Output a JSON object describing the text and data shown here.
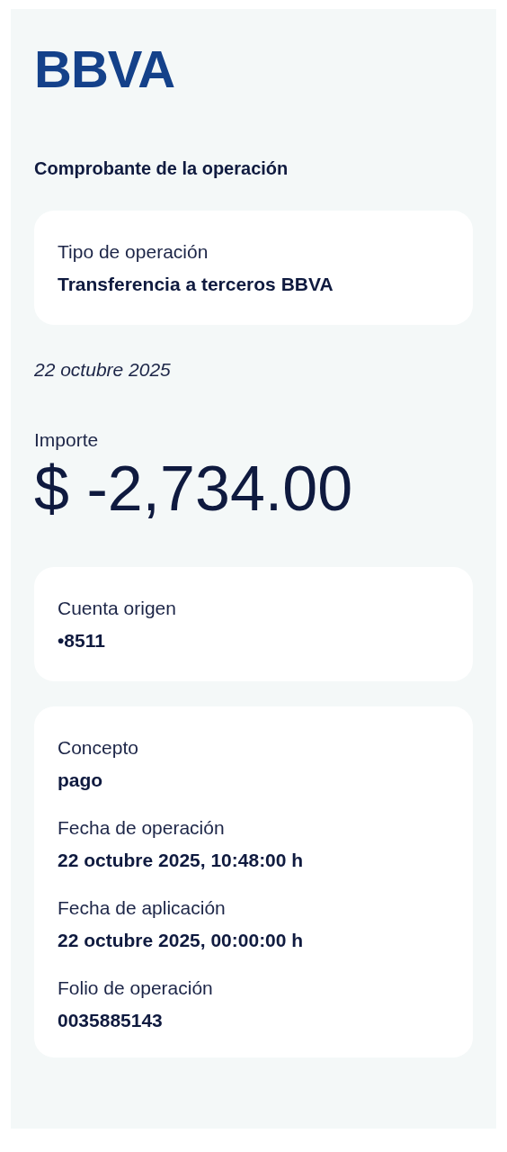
{
  "logo": "BBVA",
  "title": "Comprobante de la operación",
  "type_card": {
    "label": "Tipo de operación",
    "value": "Transferencia a terceros BBVA"
  },
  "date": "22 octubre 2025",
  "amount": {
    "label": "Importe",
    "value": "$ -2,734.00"
  },
  "account_card": {
    "label": "Cuenta origen",
    "value": "•8511"
  },
  "details": [
    {
      "label": "Concepto",
      "value": "pago"
    },
    {
      "label": "Fecha de operación",
      "value": "22 octubre 2025, 10:48:00 h"
    },
    {
      "label": "Fecha de aplicación",
      "value": "22 octubre 2025, 00:00:00 h"
    },
    {
      "label": "Folio de operación",
      "value": "0035885143"
    }
  ]
}
